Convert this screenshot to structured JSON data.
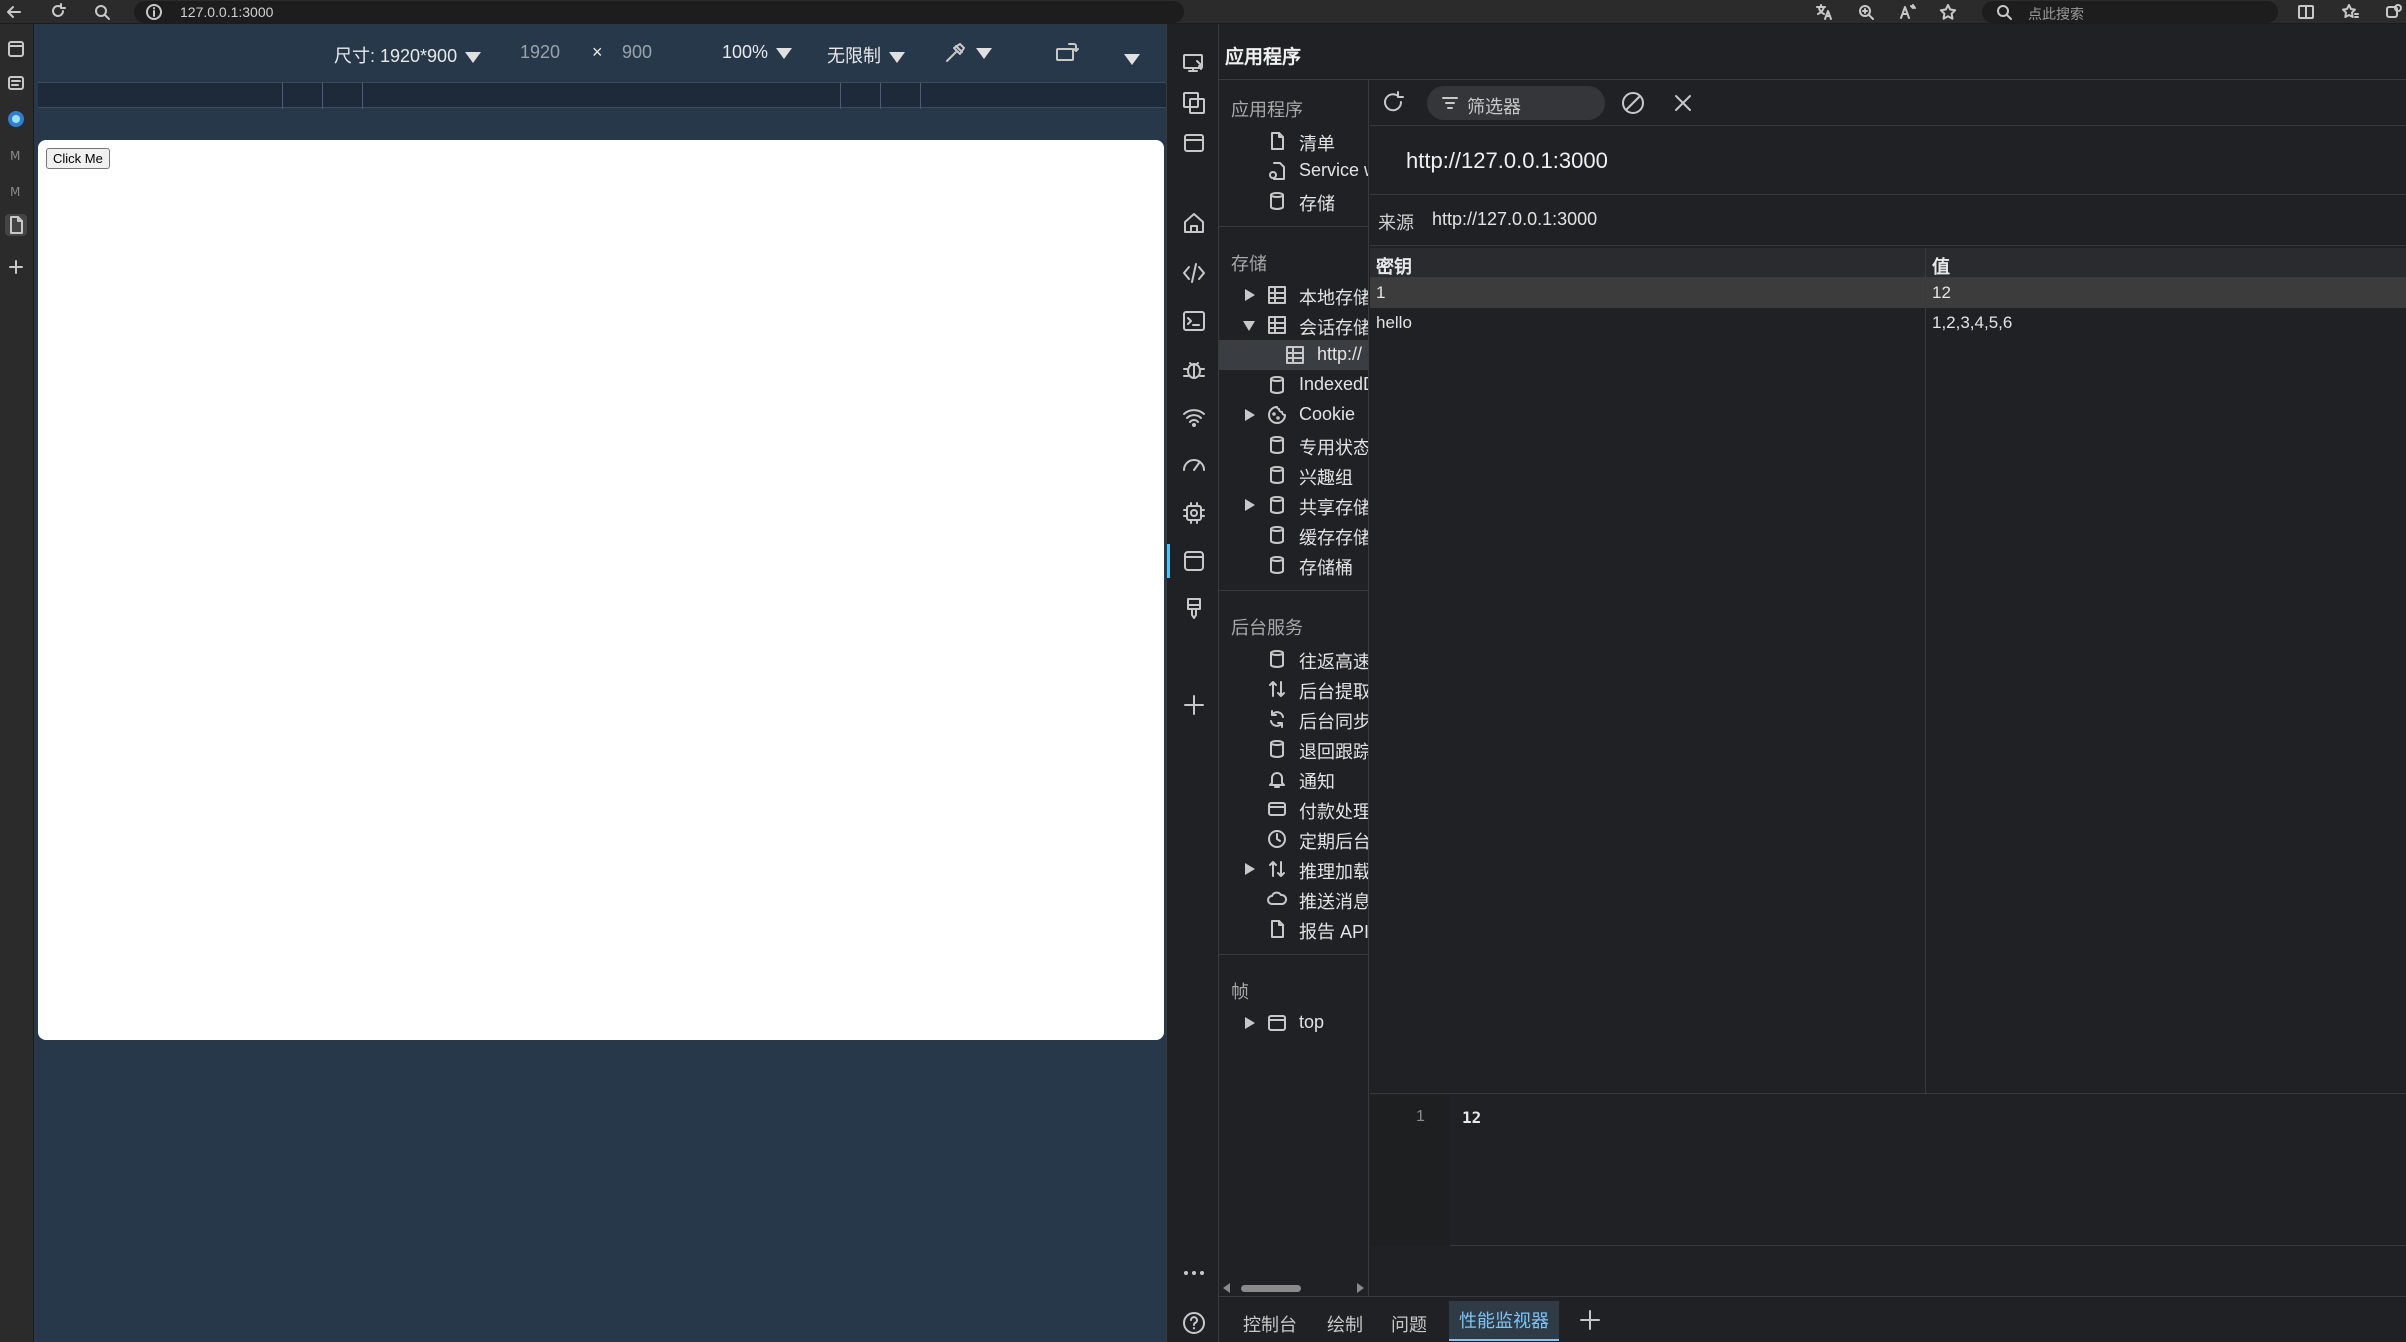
{
  "browser": {
    "address": "127.0.0.1:3000",
    "search_placeholder": "点此搜索"
  },
  "device_toolbar": {
    "dimensions_label": "尺寸: 1920*900",
    "width": "1920",
    "times": "×",
    "height": "900",
    "zoom": "100%",
    "throttle": "无限制"
  },
  "page": {
    "button_label": "Click Me"
  },
  "devtools": {
    "title": "应用程序",
    "tree": {
      "application": {
        "header": "应用程序",
        "items": [
          "清单",
          "Service w",
          "存储"
        ]
      },
      "storage": {
        "header": "存储",
        "items": [
          "本地存储",
          "会话存储",
          "http://",
          "IndexedD",
          "Cookie",
          "专用状态",
          "兴趣组",
          "共享存储",
          "缓存存储",
          "存储桶"
        ]
      },
      "background": {
        "header": "后台服务",
        "items": [
          "往返高速",
          "后台提取",
          "后台同步",
          "退回跟踪",
          "通知",
          "付款处理",
          "定期后台",
          "推理加载",
          "推送消息",
          "报告 API"
        ]
      },
      "frames": {
        "header": "帧",
        "items": [
          "top"
        ]
      }
    },
    "filter_placeholder": "筛选器",
    "origin_url": "http://127.0.0.1:3000",
    "origin_label": "来源",
    "origin_value": "http://127.0.0.1:3000",
    "table": {
      "headers": [
        "密钥",
        "值"
      ],
      "rows": [
        {
          "key": "1",
          "value": "12"
        },
        {
          "key": "hello",
          "value": "1,2,3,4,5,6"
        }
      ]
    },
    "preview": {
      "line": "1",
      "value": "12"
    },
    "drawer_tabs": [
      "控制台",
      "绘制",
      "问题",
      "性能监视器"
    ]
  }
}
